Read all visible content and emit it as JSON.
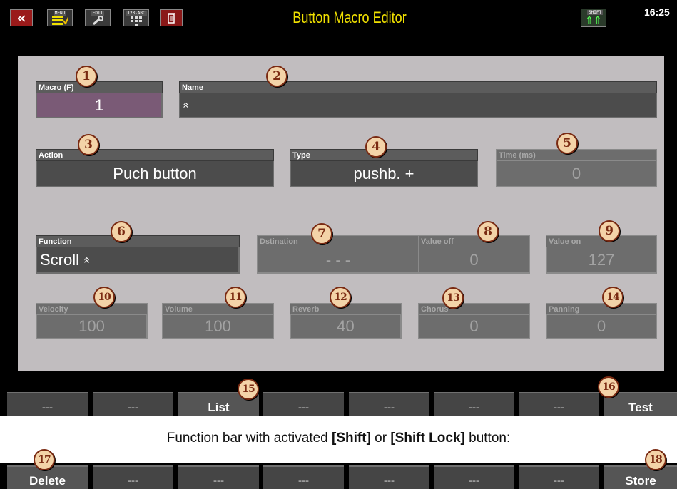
{
  "topbar": {
    "back_icon": "«",
    "menu_mini": "MENU",
    "edit_mini": "EDIT",
    "abc_mini": "123-ABC",
    "title": "Button Macro Editor",
    "shift_mini": "SHIFT",
    "clock": "16:25"
  },
  "fields": {
    "macro": {
      "label": "Macro (F)",
      "value": "1"
    },
    "name": {
      "label": "Name",
      "value": "«"
    },
    "action": {
      "label": "Action",
      "value": "Puch button"
    },
    "type": {
      "label": "Type",
      "value": "pushb. +"
    },
    "time": {
      "label": "Time (ms)",
      "value": "0"
    },
    "function": {
      "label": "Function",
      "value": "Scroll «"
    },
    "destination": {
      "label": "Dstination",
      "value": "- - -"
    },
    "value_off": {
      "label": "Value off",
      "value": "0"
    },
    "value_on": {
      "label": "Value on",
      "value": "127"
    },
    "velocity": {
      "label": "Velocity",
      "value": "100"
    },
    "volume": {
      "label": "Volume",
      "value": "100"
    },
    "reverb": {
      "label": "Reverb",
      "value": "40"
    },
    "chorus": {
      "label": "Chorus",
      "value": "0"
    },
    "panning": {
      "label": "Panning",
      "value": "0"
    }
  },
  "callouts": [
    "1",
    "2",
    "3",
    "4",
    "5",
    "6",
    "7",
    "8",
    "9",
    "10",
    "11",
    "12",
    "13",
    "14",
    "15",
    "16",
    "17",
    "18"
  ],
  "function_bar": [
    "---",
    "---",
    "List",
    "---",
    "---",
    "---",
    "---",
    "Test"
  ],
  "caption": {
    "pre": "Function bar with activated ",
    "shift": "[Shift]",
    "mid": " or ",
    "shift_lock": "[Shift Lock]",
    "post": " button:"
  },
  "function_bar_shift": [
    "Delete",
    "---",
    "---",
    "---",
    "---",
    "---",
    "---",
    "Store"
  ],
  "colors": {
    "title": "#f0e000",
    "panel": "#c1bdbf",
    "macro_value_bg": "#7a5a76",
    "callout_border": "#7a2a12"
  }
}
